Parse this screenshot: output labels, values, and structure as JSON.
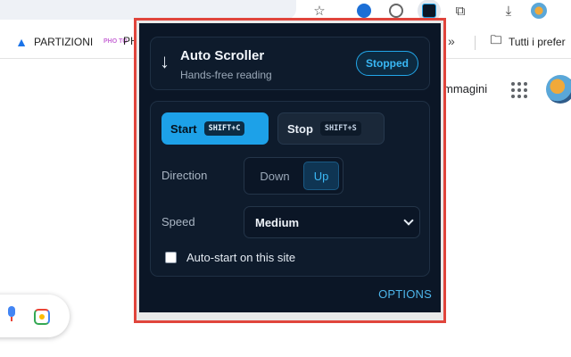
{
  "browser": {
    "bookmarks": [
      {
        "label": "PARTIZIONI",
        "icon": "drive-icon"
      },
      {
        "label": "PH",
        "icon": "photo-icon",
        "icon_text": "PHO TO"
      },
      {
        "label": "Tutti i prefer",
        "icon": "folder-icon"
      }
    ],
    "more_glyph": "»"
  },
  "page": {
    "images_link": "mmagini"
  },
  "popup": {
    "title": "Auto Scroller",
    "subtitle": "Hands-free reading",
    "status": "Stopped",
    "start_label": "Start",
    "start_shortcut": "SHIFT+C",
    "stop_label": "Stop",
    "stop_shortcut": "SHIFT+S",
    "direction_label": "Direction",
    "direction_options": [
      "Down",
      "Up"
    ],
    "direction_selected": "Up",
    "speed_label": "Speed",
    "speed_value": "Medium",
    "autostart_label": "Auto-start on this site",
    "autostart_checked": false,
    "options_link": "OPTIONS"
  },
  "colors": {
    "accent": "#1da1e8",
    "popup_bg": "#0b1626",
    "highlight_border": "#e0453c"
  }
}
